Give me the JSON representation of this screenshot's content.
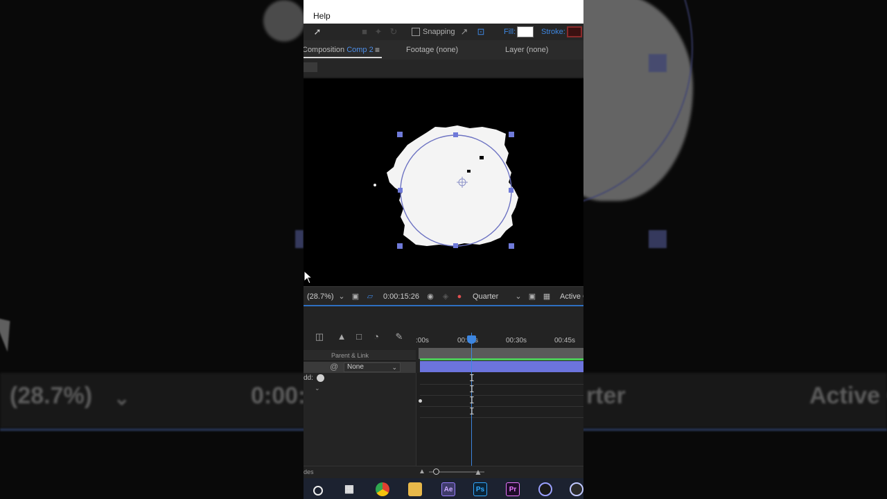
{
  "menubar": {
    "help": "Help"
  },
  "toolbar": {
    "snapping": "Snapping",
    "fill_label": "Fill:",
    "stroke_label": "Stroke:",
    "fill_color": "#ffffff",
    "stroke_color": "#8a2a2a"
  },
  "tabs": {
    "composition_prefix": "Composition",
    "composition_name": "Comp 2",
    "footage": "Footage (none)",
    "layer": "Layer (none)"
  },
  "viewer_bar": {
    "zoom": "(28.7%)",
    "timecode": "0:00:15:26",
    "resolution": "Quality",
    "resolution_value": "Quarter",
    "view": "Active C"
  },
  "timeline": {
    "ticks": [
      ":00s",
      "00:15s",
      "00:30s",
      "00:45s"
    ],
    "parent_link": "Parent & Link",
    "parent_value": "None",
    "add_label": "dd:",
    "bottom_label": "des"
  },
  "background": {
    "zoom_text": "(28.7%)",
    "time_text": "0:00:",
    "quality_text": "rter",
    "active_text": "Active C"
  },
  "taskbar": {
    "apps": [
      "search-icon",
      "task-view-icon",
      "chrome-icon",
      "file-explorer-icon",
      "Ae",
      "Ps",
      "Pr",
      "cinema4d-icon",
      "app-icon"
    ]
  },
  "accent": "#3d86e0"
}
